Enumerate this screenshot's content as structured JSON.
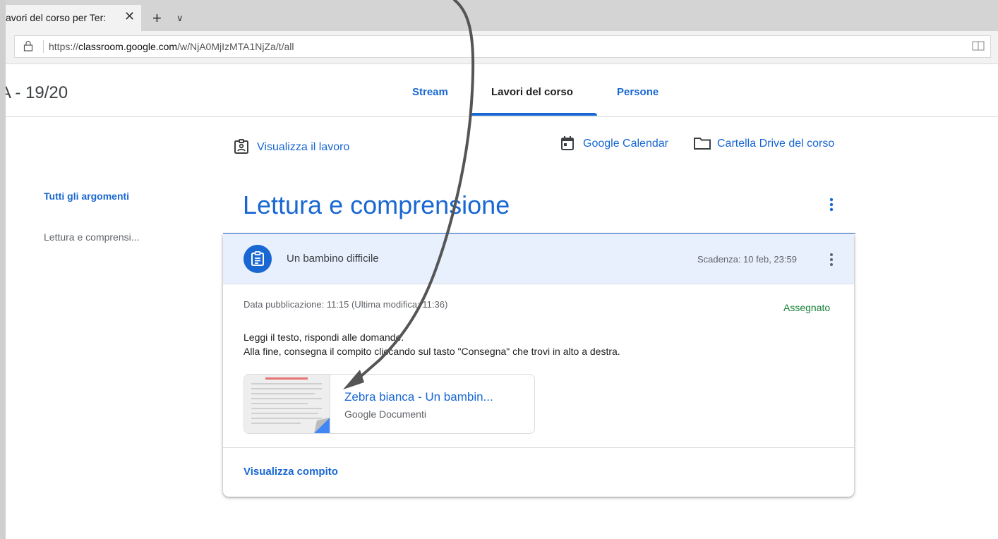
{
  "browser": {
    "tab_title": "avori del corso per Ter:",
    "tab_close": "✕",
    "new_tab": "+",
    "tab_menu": "∨",
    "url_prefix": "https://",
    "url_domain": "classroom.google.com",
    "url_path": "/w/NjA0MjIzMTA1NjZa/t/all"
  },
  "header": {
    "course_title": "A - 19/20",
    "tabs": [
      {
        "label": "Stream"
      },
      {
        "label": "Lavori del corso"
      },
      {
        "label": "Persone"
      }
    ],
    "active_tab": "Lavori del corso"
  },
  "actions": {
    "view_work": "Visualizza il lavoro",
    "calendar": "Google Calendar",
    "drive_folder": "Cartella Drive del corso"
  },
  "sidebar": {
    "all_topics": "Tutti gli argomenti",
    "items": [
      {
        "label": "Lettura e comprensi..."
      }
    ]
  },
  "topic": {
    "title": "Lettura e comprensione"
  },
  "assignment": {
    "title": "Un bambino difficile",
    "due": "Scadenza: 10 feb, 23:59",
    "posted": "Data pubblicazione: 11:15 (Ultima modifica: 11:36)",
    "status": "Assegnato",
    "instructions": [
      "Leggi il testo, rispondi alle domande.",
      "Alla fine, consegna il compito cliccando sul tasto \"Consegna\" che trovi in alto a destra."
    ],
    "attachment": {
      "title": "Zebra bianca - Un bambin...",
      "type": "Google Documenti"
    },
    "view_link": "Visualizza compito"
  },
  "colors": {
    "accent": "#1967d2",
    "status_green": "#188038",
    "header_bg": "#e8f0fe",
    "annotation": "#555555"
  }
}
